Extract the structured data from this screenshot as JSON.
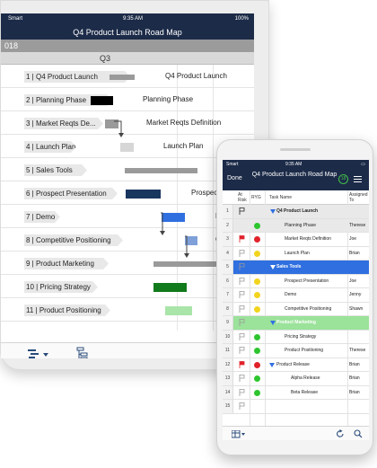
{
  "tablet": {
    "status": {
      "carrier": "Smart",
      "time": "9:35 AM",
      "battery": "100%"
    },
    "title": "Q4 Product Launch Road Map",
    "year_label": "018",
    "quarter_label": "Q3",
    "rows": [
      {
        "label": "1 | Q4 Product Launch",
        "side_text": "Q4 Product Launch"
      },
      {
        "label": "2 | Planning Phase",
        "side_text": "Planning Phase"
      },
      {
        "label": "3 | Market Reqts De...",
        "side_text": "Market Reqts Definition"
      },
      {
        "label": "4 | Launch Plan",
        "side_text": "Launch Plan"
      },
      {
        "label": "5 | Sales Tools",
        "side_text": ""
      },
      {
        "label": "6 | Prospect Presentation",
        "side_text": "Prospec"
      },
      {
        "label": "7 | Demo",
        "side_text": "D"
      },
      {
        "label": "8 | Competitive Positioning",
        "side_text": "C"
      },
      {
        "label": "9 | Product Marketing",
        "side_text": ""
      },
      {
        "label": "10 | Pricing Strategy",
        "side_text": ""
      },
      {
        "label": "11 | Product Positioning",
        "side_text": ""
      }
    ]
  },
  "phone": {
    "status": {
      "carrier": "Smart",
      "time": "9:35 AM"
    },
    "done_label": "Done",
    "title": "Q4 Product Launch Road Map",
    "badge": "18",
    "columns": {
      "at_risk": "At Risk",
      "ryg": "RYG",
      "task": "Task Name",
      "assigned": "Assigned To"
    },
    "rows": [
      {
        "num": "1",
        "task": "Q4 Product Launch",
        "assigned": "",
        "ryg": "",
        "flag": "outline",
        "style": "grey",
        "bold": true,
        "tri": true
      },
      {
        "num": "2",
        "task": "Planning Phase",
        "assigned": "Therese",
        "ryg": "green",
        "flag": "none",
        "style": "grey"
      },
      {
        "num": "3",
        "task": "Market Reqts Definition",
        "assigned": "Joe",
        "ryg": "red",
        "flag": "red",
        "style": ""
      },
      {
        "num": "4",
        "task": "Launch Plan",
        "assigned": "Brian",
        "ryg": "yellow",
        "flag": "outline",
        "style": ""
      },
      {
        "num": "5",
        "task": "Sales Tools",
        "assigned": "",
        "ryg": "",
        "flag": "outline",
        "style": "blue",
        "bold": true,
        "tri": true
      },
      {
        "num": "6",
        "task": "Prospect Presentation",
        "assigned": "Joe",
        "ryg": "yellow",
        "flag": "outline",
        "style": ""
      },
      {
        "num": "7",
        "task": "Demo",
        "assigned": "Jenny",
        "ryg": "yellow",
        "flag": "outline",
        "style": ""
      },
      {
        "num": "8",
        "task": "Competitive Positioning",
        "assigned": "Shawn",
        "ryg": "yellow",
        "flag": "outline",
        "style": ""
      },
      {
        "num": "9",
        "task": "Product Marketing",
        "assigned": "",
        "ryg": "",
        "flag": "outline",
        "style": "green",
        "bold": true,
        "tri": true
      },
      {
        "num": "10",
        "task": "Pricing Strategy",
        "assigned": "",
        "ryg": "green",
        "flag": "outline",
        "style": ""
      },
      {
        "num": "11",
        "task": "Product Positioning",
        "assigned": "Therese",
        "ryg": "green",
        "flag": "outline",
        "style": ""
      },
      {
        "num": "12",
        "task": "Product Release",
        "assigned": "Brian",
        "ryg": "red",
        "flag": "red",
        "style": "",
        "tri": true
      },
      {
        "num": "13",
        "task": "Alpha Release",
        "assigned": "Brian",
        "ryg": "green",
        "flag": "outline",
        "style": "",
        "indent": true
      },
      {
        "num": "14",
        "task": "Beta Release",
        "assigned": "Brian",
        "ryg": "green",
        "flag": "outline",
        "style": "",
        "indent": true
      },
      {
        "num": "15",
        "task": "",
        "assigned": "",
        "ryg": "",
        "flag": "outline",
        "style": ""
      }
    ]
  },
  "colors": {
    "header_navy": "#1c2b48",
    "ryg_green": "#2ec52e",
    "ryg_yellow": "#f2d41f",
    "ryg_red": "#e0232b",
    "section_blue": "#2f6fe0",
    "section_green": "#9be29b"
  },
  "icons": {
    "tablet_toolbar": [
      "gantt-view-icon",
      "hierarchy-icon",
      "refresh-icon"
    ],
    "phone_footer": [
      "grid-view-icon",
      "refresh-icon",
      "search-icon"
    ]
  }
}
